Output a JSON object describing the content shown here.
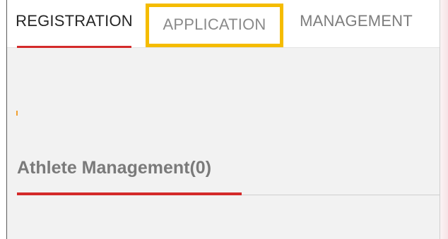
{
  "tabs": {
    "registration": "REGISTRATION",
    "application": "APPLICATION",
    "management": "MANAGEMENT"
  },
  "section": {
    "title": "Athlete Management(0)"
  },
  "colors": {
    "active_underline": "#d42a2a",
    "highlight_box": "#f5bc00",
    "panel_background": "#f2f2f2"
  }
}
